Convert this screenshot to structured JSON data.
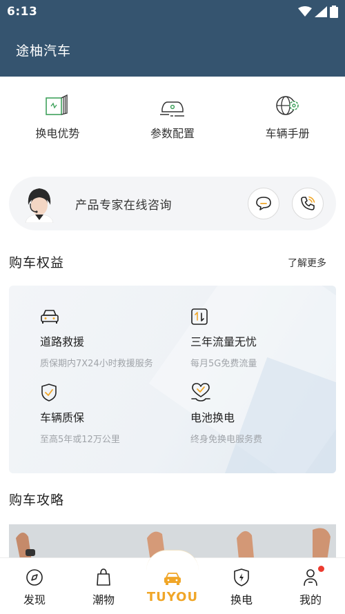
{
  "status_bar": {
    "time": "6:13",
    "icons": [
      "wifi-icon",
      "signal-icon",
      "battery-icon"
    ]
  },
  "app_bar": {
    "title": "途柚汽车"
  },
  "quick_nav": [
    {
      "label": "换电优势",
      "icon": "battery-swap-icon"
    },
    {
      "label": "参数配置",
      "icon": "car-params-icon"
    },
    {
      "label": "车辆手册",
      "icon": "globe-gear-icon"
    }
  ],
  "consult": {
    "text": "产品专家在线咨询",
    "chat_icon": "chat-bubble-icon",
    "phone_icon": "phone-icon"
  },
  "benefits_section": {
    "title": "购车权益",
    "more": "了解更多",
    "items": [
      {
        "title": "道路救援",
        "desc": "质保期内7X24小时救援服务",
        "icon": "car-rescue-icon"
      },
      {
        "title": "三年流量无忧",
        "desc": "每月5G免费流量",
        "icon": "data-traffic-icon"
      },
      {
        "title": "车辆质保",
        "desc": "至高5年或12万公里",
        "icon": "shield-check-icon"
      },
      {
        "title": "电池换电",
        "desc": "终身免换电服务费",
        "icon": "heart-battery-icon"
      }
    ]
  },
  "guide_section": {
    "title": "购车攻略"
  },
  "tab_bar": {
    "tabs": [
      {
        "label": "发现",
        "icon": "compass-icon"
      },
      {
        "label": "潮物",
        "icon": "shopping-bag-icon"
      },
      {
        "label": "TUYOU",
        "icon": "car-home-icon"
      },
      {
        "label": "换电",
        "icon": "lightning-shield-icon"
      },
      {
        "label": "我的",
        "icon": "person-icon"
      }
    ],
    "brand_text": "TUYOU",
    "accent": "#f0a628",
    "badge_color": "#ec3b2f"
  },
  "colors": {
    "header": "#35546f",
    "icon_green": "#3fa25c",
    "accent_orange": "#f0a628"
  }
}
